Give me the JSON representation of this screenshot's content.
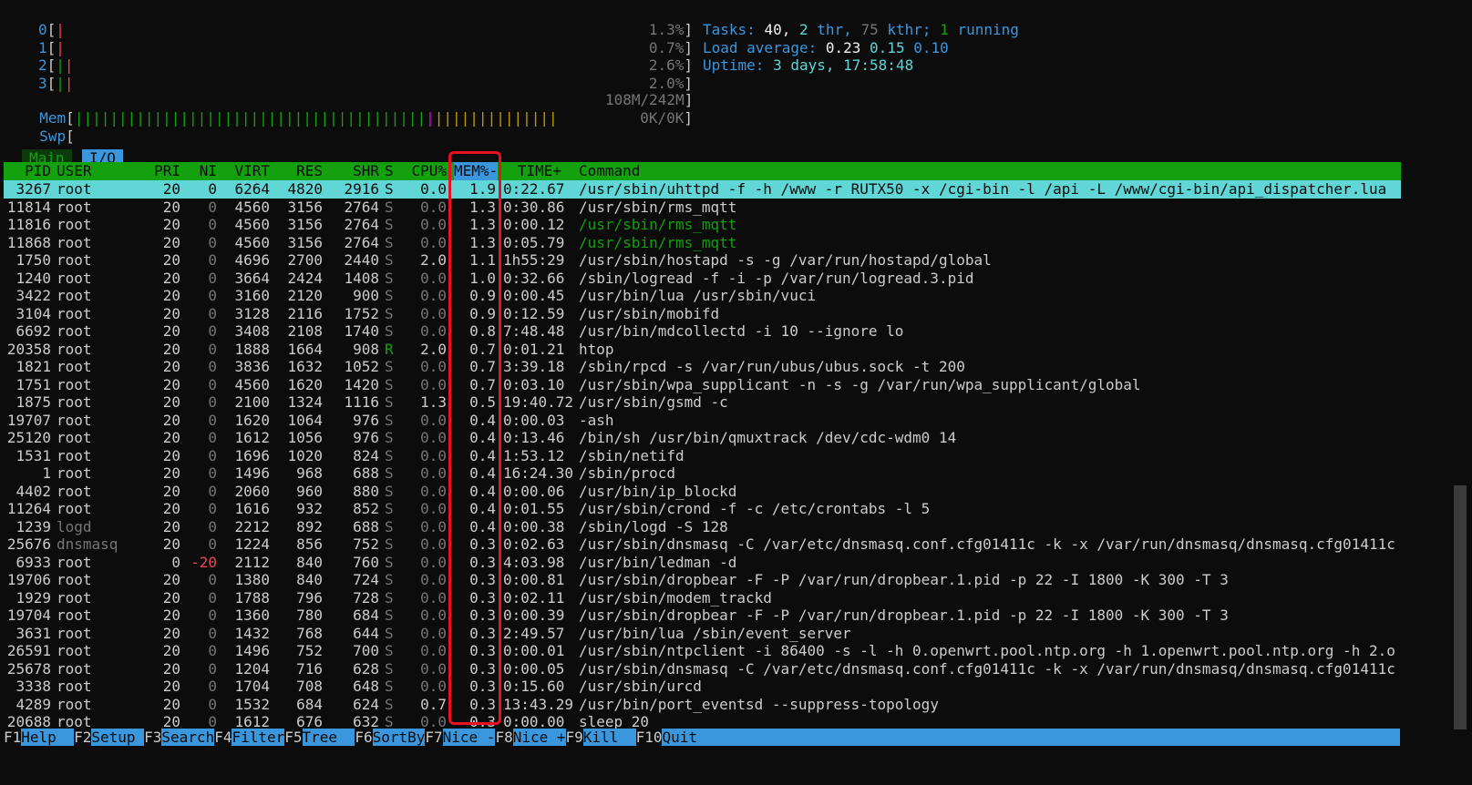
{
  "meters": {
    "cpus": [
      {
        "label": "0",
        "pct": "1.3%",
        "bar_green": 0,
        "bar_red": 1
      },
      {
        "label": "1",
        "pct": "0.7%",
        "bar_green": 0,
        "bar_red": 1
      },
      {
        "label": "2",
        "pct": "2.6%",
        "bar_green": 1,
        "bar_red": 1
      },
      {
        "label": "3",
        "pct": "2.0%",
        "bar_green": 1,
        "bar_red": 1
      }
    ],
    "mem": {
      "label": "Mem",
      "value": "108M/242M"
    },
    "swp": {
      "label": "Swp",
      "value": "0K/0K"
    }
  },
  "stats": {
    "tasks_label": "Tasks:",
    "tasks": "40,",
    "thr": "2",
    "thr_label": "thr,",
    "kthr": "75",
    "kthr_label": "kthr;",
    "running": "1",
    "running_label": "running",
    "load_label": "Load average:",
    "load1": "0.23",
    "load5": "0.15",
    "load15": "0.10",
    "uptime_label": "Uptime:",
    "uptime": "3 days, 17:58:48"
  },
  "tabs": {
    "main": "Main",
    "io": "I/O"
  },
  "columns": {
    "pid": "PID",
    "user": "USER",
    "pri": "PRI",
    "ni": "NI",
    "virt": "VIRT",
    "res": "RES",
    "shr": "SHR",
    "s": "S",
    "cpu": "CPU%",
    "mem": "MEM%-",
    "time": "TIME+",
    "cmd": "Command"
  },
  "processes": [
    {
      "pid": "3267",
      "user": "root",
      "pri": "20",
      "ni": "0",
      "virt": "6264",
      "res": "4820",
      "shr": "2916",
      "s": "S",
      "cpu": "0.0",
      "mem": "1.9",
      "time": "0:22.67",
      "cmd": "/usr/sbin/uhttpd -f -h /www -r RUTX50 -x /cgi-bin -l /api -L /www/cgi-bin/api_dispatcher.lua"
    },
    {
      "pid": "11814",
      "user": "root",
      "pri": "20",
      "ni": "0",
      "virt": "4560",
      "res": "3156",
      "shr": "2764",
      "s": "S",
      "cpu": "0.0",
      "mem": "1.3",
      "time": "0:30.86",
      "cmd": "/usr/sbin/rms_mqtt"
    },
    {
      "pid": "11816",
      "user": "root",
      "pri": "20",
      "ni": "0",
      "virt": "4560",
      "res": "3156",
      "shr": "2764",
      "s": "S",
      "cpu": "0.0",
      "mem": "1.3",
      "time": "0:00.12",
      "cmd": "/usr/sbin/rms_mqtt"
    },
    {
      "pid": "11868",
      "user": "root",
      "pri": "20",
      "ni": "0",
      "virt": "4560",
      "res": "3156",
      "shr": "2764",
      "s": "S",
      "cpu": "0.0",
      "mem": "1.3",
      "time": "0:05.79",
      "cmd": "/usr/sbin/rms_mqtt"
    },
    {
      "pid": "1750",
      "user": "root",
      "pri": "20",
      "ni": "0",
      "virt": "4696",
      "res": "2700",
      "shr": "2440",
      "s": "S",
      "cpu": "2.0",
      "mem": "1.1",
      "time": "1h55:29",
      "cmd": "/usr/sbin/hostapd -s -g /var/run/hostapd/global"
    },
    {
      "pid": "1240",
      "user": "root",
      "pri": "20",
      "ni": "0",
      "virt": "3664",
      "res": "2424",
      "shr": "1408",
      "s": "S",
      "cpu": "0.0",
      "mem": "1.0",
      "time": "0:32.66",
      "cmd": "/sbin/logread -f -i -p /var/run/logread.3.pid"
    },
    {
      "pid": "3422",
      "user": "root",
      "pri": "20",
      "ni": "0",
      "virt": "3160",
      "res": "2120",
      "shr": "900",
      "s": "S",
      "cpu": "0.0",
      "mem": "0.9",
      "time": "0:00.45",
      "cmd": "/usr/bin/lua /usr/sbin/vuci"
    },
    {
      "pid": "3104",
      "user": "root",
      "pri": "20",
      "ni": "0",
      "virt": "3128",
      "res": "2116",
      "shr": "1752",
      "s": "S",
      "cpu": "0.0",
      "mem": "0.9",
      "time": "0:12.59",
      "cmd": "/usr/sbin/mobifd"
    },
    {
      "pid": "6692",
      "user": "root",
      "pri": "20",
      "ni": "0",
      "virt": "3408",
      "res": "2108",
      "shr": "1740",
      "s": "S",
      "cpu": "0.0",
      "mem": "0.8",
      "time": "7:48.48",
      "cmd": "/usr/bin/mdcollectd -i 10 --ignore lo"
    },
    {
      "pid": "20358",
      "user": "root",
      "pri": "20",
      "ni": "0",
      "virt": "1888",
      "res": "1664",
      "shr": "908",
      "s": "R",
      "cpu": "2.0",
      "mem": "0.7",
      "time": "0:01.21",
      "cmd": "htop"
    },
    {
      "pid": "1821",
      "user": "root",
      "pri": "20",
      "ni": "0",
      "virt": "3836",
      "res": "1632",
      "shr": "1052",
      "s": "S",
      "cpu": "0.0",
      "mem": "0.7",
      "time": "3:39.18",
      "cmd": "/sbin/rpcd -s /var/run/ubus/ubus.sock -t 200"
    },
    {
      "pid": "1751",
      "user": "root",
      "pri": "20",
      "ni": "0",
      "virt": "4560",
      "res": "1620",
      "shr": "1420",
      "s": "S",
      "cpu": "0.0",
      "mem": "0.7",
      "time": "0:03.10",
      "cmd": "/usr/sbin/wpa_supplicant -n -s -g /var/run/wpa_supplicant/global"
    },
    {
      "pid": "1875",
      "user": "root",
      "pri": "20",
      "ni": "0",
      "virt": "2100",
      "res": "1324",
      "shr": "1116",
      "s": "S",
      "cpu": "1.3",
      "mem": "0.5",
      "time": "19:40.72",
      "cmd": "/usr/sbin/gsmd -c"
    },
    {
      "pid": "19707",
      "user": "root",
      "pri": "20",
      "ni": "0",
      "virt": "1620",
      "res": "1064",
      "shr": "976",
      "s": "S",
      "cpu": "0.0",
      "mem": "0.4",
      "time": "0:00.03",
      "cmd": "-ash"
    },
    {
      "pid": "25120",
      "user": "root",
      "pri": "20",
      "ni": "0",
      "virt": "1612",
      "res": "1056",
      "shr": "976",
      "s": "S",
      "cpu": "0.0",
      "mem": "0.4",
      "time": "0:13.46",
      "cmd": "/bin/sh /usr/bin/qmuxtrack /dev/cdc-wdm0 14"
    },
    {
      "pid": "1531",
      "user": "root",
      "pri": "20",
      "ni": "0",
      "virt": "1696",
      "res": "1020",
      "shr": "824",
      "s": "S",
      "cpu": "0.0",
      "mem": "0.4",
      "time": "1:53.12",
      "cmd": "/sbin/netifd"
    },
    {
      "pid": "1",
      "user": "root",
      "pri": "20",
      "ni": "0",
      "virt": "1496",
      "res": "968",
      "shr": "688",
      "s": "S",
      "cpu": "0.0",
      "mem": "0.4",
      "time": "16:24.30",
      "cmd": "/sbin/procd"
    },
    {
      "pid": "4402",
      "user": "root",
      "pri": "20",
      "ni": "0",
      "virt": "2060",
      "res": "960",
      "shr": "880",
      "s": "S",
      "cpu": "0.0",
      "mem": "0.4",
      "time": "0:00.06",
      "cmd": "/usr/bin/ip_blockd"
    },
    {
      "pid": "11264",
      "user": "root",
      "pri": "20",
      "ni": "0",
      "virt": "1616",
      "res": "932",
      "shr": "852",
      "s": "S",
      "cpu": "0.0",
      "mem": "0.4",
      "time": "0:01.55",
      "cmd": "/usr/sbin/crond -f -c /etc/crontabs -l 5"
    },
    {
      "pid": "1239",
      "user": "logd",
      "pri": "20",
      "ni": "0",
      "virt": "2212",
      "res": "892",
      "shr": "688",
      "s": "S",
      "cpu": "0.0",
      "mem": "0.4",
      "time": "0:00.38",
      "cmd": "/sbin/logd -S 128"
    },
    {
      "pid": "25676",
      "user": "dnsmasq",
      "pri": "20",
      "ni": "0",
      "virt": "1224",
      "res": "856",
      "shr": "752",
      "s": "S",
      "cpu": "0.0",
      "mem": "0.3",
      "time": "0:02.63",
      "cmd": "/usr/sbin/dnsmasq -C /var/etc/dnsmasq.conf.cfg01411c -k -x /var/run/dnsmasq/dnsmasq.cfg01411c"
    },
    {
      "pid": "6933",
      "user": "root",
      "pri": "0",
      "ni": "-20",
      "virt": "2112",
      "res": "840",
      "shr": "760",
      "s": "S",
      "cpu": "0.0",
      "mem": "0.3",
      "time": "4:03.98",
      "cmd": "/usr/bin/ledman -d"
    },
    {
      "pid": "19706",
      "user": "root",
      "pri": "20",
      "ni": "0",
      "virt": "1380",
      "res": "840",
      "shr": "724",
      "s": "S",
      "cpu": "0.0",
      "mem": "0.3",
      "time": "0:00.81",
      "cmd": "/usr/sbin/dropbear -F -P /var/run/dropbear.1.pid -p 22 -I 1800 -K 300 -T 3"
    },
    {
      "pid": "1929",
      "user": "root",
      "pri": "20",
      "ni": "0",
      "virt": "1788",
      "res": "796",
      "shr": "728",
      "s": "S",
      "cpu": "0.0",
      "mem": "0.3",
      "time": "0:02.11",
      "cmd": "/usr/sbin/modem_trackd"
    },
    {
      "pid": "19704",
      "user": "root",
      "pri": "20",
      "ni": "0",
      "virt": "1360",
      "res": "780",
      "shr": "684",
      "s": "S",
      "cpu": "0.0",
      "mem": "0.3",
      "time": "0:00.39",
      "cmd": "/usr/sbin/dropbear -F -P /var/run/dropbear.1.pid -p 22 -I 1800 -K 300 -T 3"
    },
    {
      "pid": "3631",
      "user": "root",
      "pri": "20",
      "ni": "0",
      "virt": "1432",
      "res": "768",
      "shr": "644",
      "s": "S",
      "cpu": "0.0",
      "mem": "0.3",
      "time": "2:49.57",
      "cmd": "/usr/bin/lua /sbin/event_server"
    },
    {
      "pid": "26591",
      "user": "root",
      "pri": "20",
      "ni": "0",
      "virt": "1496",
      "res": "752",
      "shr": "700",
      "s": "S",
      "cpu": "0.0",
      "mem": "0.3",
      "time": "0:00.01",
      "cmd": "/usr/sbin/ntpclient -i 86400 -s -l -h 0.openwrt.pool.ntp.org -h 1.openwrt.pool.ntp.org -h 2.o"
    },
    {
      "pid": "25678",
      "user": "root",
      "pri": "20",
      "ni": "0",
      "virt": "1204",
      "res": "716",
      "shr": "628",
      "s": "S",
      "cpu": "0.0",
      "mem": "0.3",
      "time": "0:00.05",
      "cmd": "/usr/sbin/dnsmasq -C /var/etc/dnsmasq.conf.cfg01411c -k -x /var/run/dnsmasq/dnsmasq.cfg01411c"
    },
    {
      "pid": "3338",
      "user": "root",
      "pri": "20",
      "ni": "0",
      "virt": "1704",
      "res": "708",
      "shr": "648",
      "s": "S",
      "cpu": "0.0",
      "mem": "0.3",
      "time": "0:15.60",
      "cmd": "/usr/sbin/urcd"
    },
    {
      "pid": "4289",
      "user": "root",
      "pri": "20",
      "ni": "0",
      "virt": "1532",
      "res": "684",
      "shr": "624",
      "s": "S",
      "cpu": "0.7",
      "mem": "0.3",
      "time": "13:43.29",
      "cmd": "/usr/bin/port_eventsd --suppress-topology"
    },
    {
      "pid": "20688",
      "user": "root",
      "pri": "20",
      "ni": "0",
      "virt": "1612",
      "res": "676",
      "shr": "632",
      "s": "S",
      "cpu": "0.0",
      "mem": "0.3",
      "time": "0:00.00",
      "cmd": "sleep 20"
    }
  ],
  "footer": [
    {
      "key": "F1",
      "label": "Help  "
    },
    {
      "key": "F2",
      "label": "Setup "
    },
    {
      "key": "F3",
      "label": "Search"
    },
    {
      "key": "F4",
      "label": "Filter"
    },
    {
      "key": "F5",
      "label": "Tree  "
    },
    {
      "key": "F6",
      "label": "SortBy"
    },
    {
      "key": "F7",
      "label": "Nice -"
    },
    {
      "key": "F8",
      "label": "Nice +"
    },
    {
      "key": "F9",
      "label": "Kill  "
    },
    {
      "key": "F10",
      "label": "Quit"
    }
  ],
  "colors": {
    "header_bg": "#13a10e",
    "selected_bg": "#61d6d6",
    "footer_label_bg": "#3a96dd",
    "annotation_box": "#e81123"
  }
}
